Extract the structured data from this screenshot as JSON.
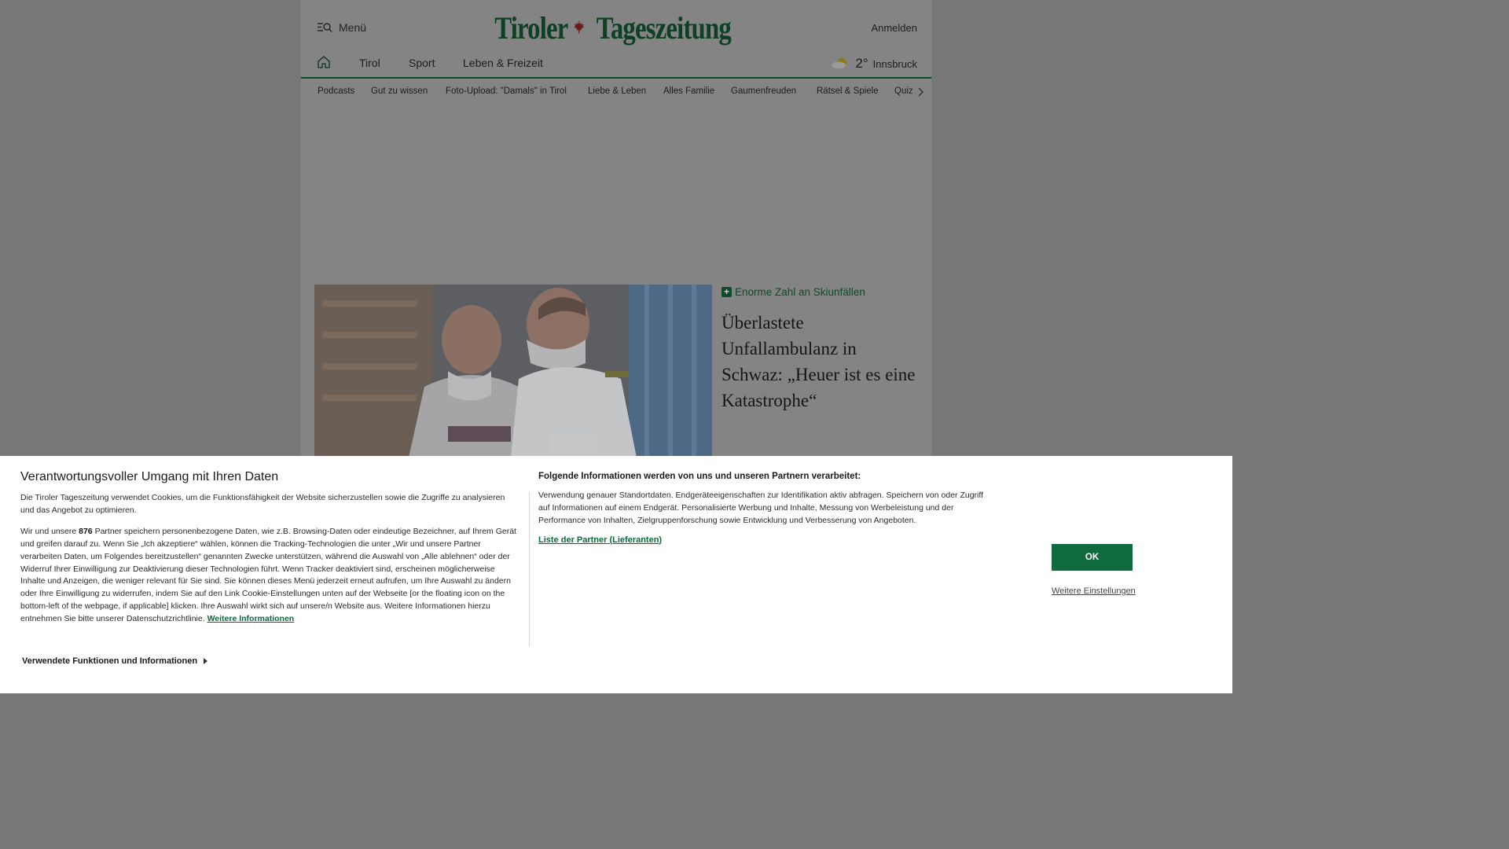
{
  "header": {
    "menu_label": "Menü",
    "logo_left": "Tiroler",
    "logo_right": "Tageszeitung",
    "login_label": "Anmelden"
  },
  "nav_primary": {
    "items": [
      "Tirol",
      "Sport",
      "Leben & Freizeit"
    ]
  },
  "weather": {
    "temperature": "2°",
    "city": "Innsbruck",
    "icon": "partly-cloudy-icon"
  },
  "nav_secondary": {
    "items": [
      "Podcasts",
      "Gut zu wissen",
      "Foto-Upload: \"Damals\" in Tirol",
      "Liebe & Leben",
      "Alles Familie",
      "Gaumenfreuden",
      "Rätsel & Spiele",
      "Quiz"
    ]
  },
  "teaser": {
    "kicker": "Enorme Zahl an Skiunfällen",
    "headline": "Überlastete Unfallambulanz in Schwaz: „Heuer ist es eine Katastrophe“"
  },
  "consent": {
    "title": "Verantwortungsvoller Umgang mit Ihren Daten",
    "para1": "Die Tiroler Tageszeitung verwendet Cookies, um die Funktionsfähigkeit der Website sicherzustellen sowie die Zugriffe zu analysieren und das Angebot zu optimieren.",
    "para2_before": "Wir und unsere ",
    "partner_count": "876",
    "para2_after": " Partner speichern personenbezogene Daten, wie z.B. Browsing-Daten oder eindeutige Bezeichner, auf Ihrem Gerät und greifen darauf zu. Wenn Sie „Ich akzeptiere“ wählen, können die Tracking-Technologien die unter „Wir und unsere Partner verarbeiten Daten, um Folgendes bereitzustellen“ genannten Zwecke unterstützen, während die Auswahl von „Alle ablehnen“ oder der Widerruf Ihrer Einwilligung zur Deaktivierung dieser Technologien führt. Wenn Tracker deaktiviert sind, erscheinen möglicherweise Inhalte und Anzeigen, die weniger relevant für Sie sind. Sie können dieses Menü jederzeit erneut aufrufen, um Ihre Auswahl zu ändern oder Ihre Einwilligung zu widerrufen, indem Sie auf den Link Cookie-Einstellungen unten auf der Webseite [or the floating icon on the bottom-left of the webpage, if applicable] klicken. Ihre Auswahl wirkt sich auf unsere/n Website aus. Weitere Informationen hierzu entnehmen Sie bitte unserer Datenschutzrichtlinie. ",
    "more_info_link": "Weitere Informationen",
    "expand_label": "Verwendete Funktionen und Informationen",
    "right_title": "Folgende Informationen werden von uns und unseren Partnern verarbeitet:",
    "right_text": "Verwendung genauer Standortdaten. Endgeräteeigenschaften zur Identifikation aktiv abfragen. Speichern von oder Zugriff auf Informationen auf einem Endgerät. Personalisierte Werbung und Inhalte, Messung von Werbeleistung und der Performance von Inhalten, Zielgruppenforschung sowie Entwicklung und Verbesserung von Angeboten.",
    "partners_link": "Liste der Partner (Lieferanten)",
    "ok_label": "OK",
    "settings_label": "Weitere Einstellungen"
  },
  "colors": {
    "brand_green": "#0f6b3d",
    "overlay_gray": "#848484",
    "banner_bg": "#ffffff"
  }
}
